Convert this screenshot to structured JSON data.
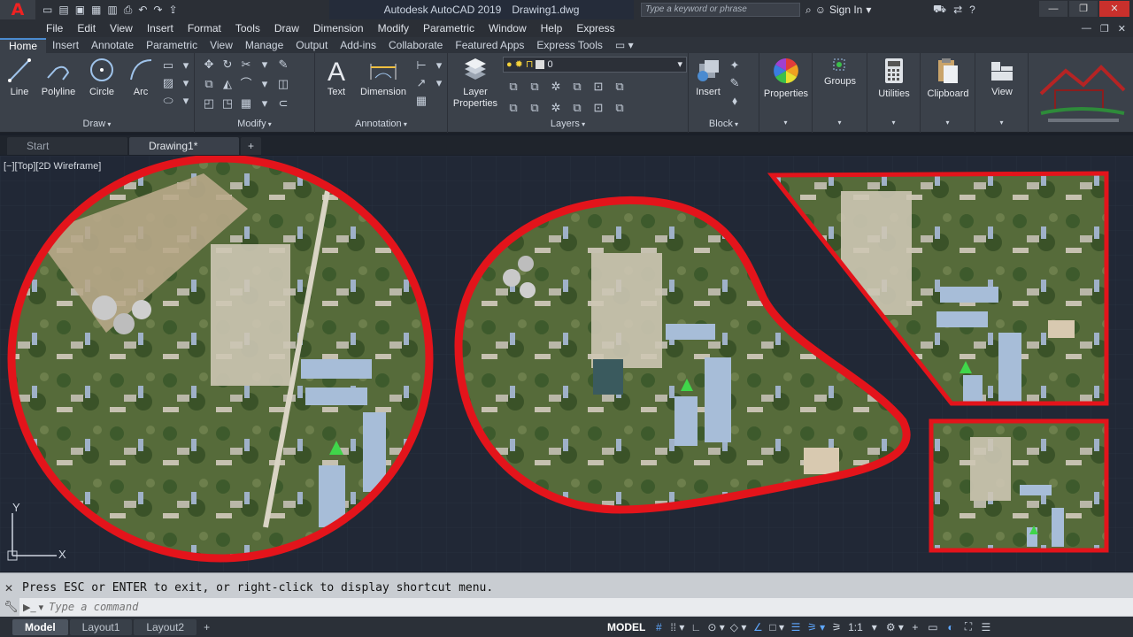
{
  "app": {
    "logo": "A",
    "title": "Autodesk AutoCAD 2019",
    "document": "Drawing1.dwg"
  },
  "titlebar": {
    "qat_icons": [
      "new-icon",
      "open-icon",
      "save-icon",
      "saveas-icon",
      "print-icon",
      "undo-icon",
      "redo-icon",
      "share-icon"
    ],
    "search_placeholder": "Type a keyword or phrase",
    "signin_label": "Sign In",
    "help_label": "?"
  },
  "menu": {
    "items": [
      "File",
      "Edit",
      "View",
      "Insert",
      "Format",
      "Tools",
      "Draw",
      "Dimension",
      "Modify",
      "Parametric",
      "Window",
      "Help",
      "Express"
    ]
  },
  "ribbon_tabs": [
    "Home",
    "Insert",
    "Annotate",
    "Parametric",
    "View",
    "Manage",
    "Output",
    "Add-ins",
    "Collaborate",
    "Featured Apps",
    "Express Tools"
  ],
  "ribbon": {
    "draw": {
      "label": "Draw",
      "tools": [
        "Line",
        "Polyline",
        "Circle",
        "Arc"
      ]
    },
    "modify": {
      "label": "Modify"
    },
    "annotation": {
      "label": "Annotation",
      "tools": [
        "Text",
        "Dimension"
      ]
    },
    "layers": {
      "label": "Layers",
      "tool_line1": "Layer",
      "tool_line2": "Properties",
      "current_layer": "0"
    },
    "block": {
      "label": "Block",
      "tool": "Insert"
    },
    "properties": {
      "label": "Properties"
    },
    "groups": {
      "label": "Groups"
    },
    "utilities": {
      "label": "Utilities"
    },
    "clipboard": {
      "label": "Clipboard"
    },
    "view": {
      "label": "View"
    }
  },
  "file_tabs": {
    "items": [
      "Start",
      "Drawing1*"
    ],
    "active": "Drawing1*",
    "add_label": "+"
  },
  "viewport": {
    "label": "[−][Top][2D Wireframe]",
    "axis_y": "Y",
    "axis_x": "X",
    "boundary_color": "#e3141b",
    "background_color": "#212836"
  },
  "command": {
    "message": "Press ESC or ENTER to exit, or right-click to display shortcut menu.",
    "placeholder": "Type a command"
  },
  "layout_tabs": [
    "Model",
    "Layout1",
    "Layout2"
  ],
  "layout_add": "+",
  "status": {
    "model_label": "MODEL",
    "scale": "1:1"
  }
}
